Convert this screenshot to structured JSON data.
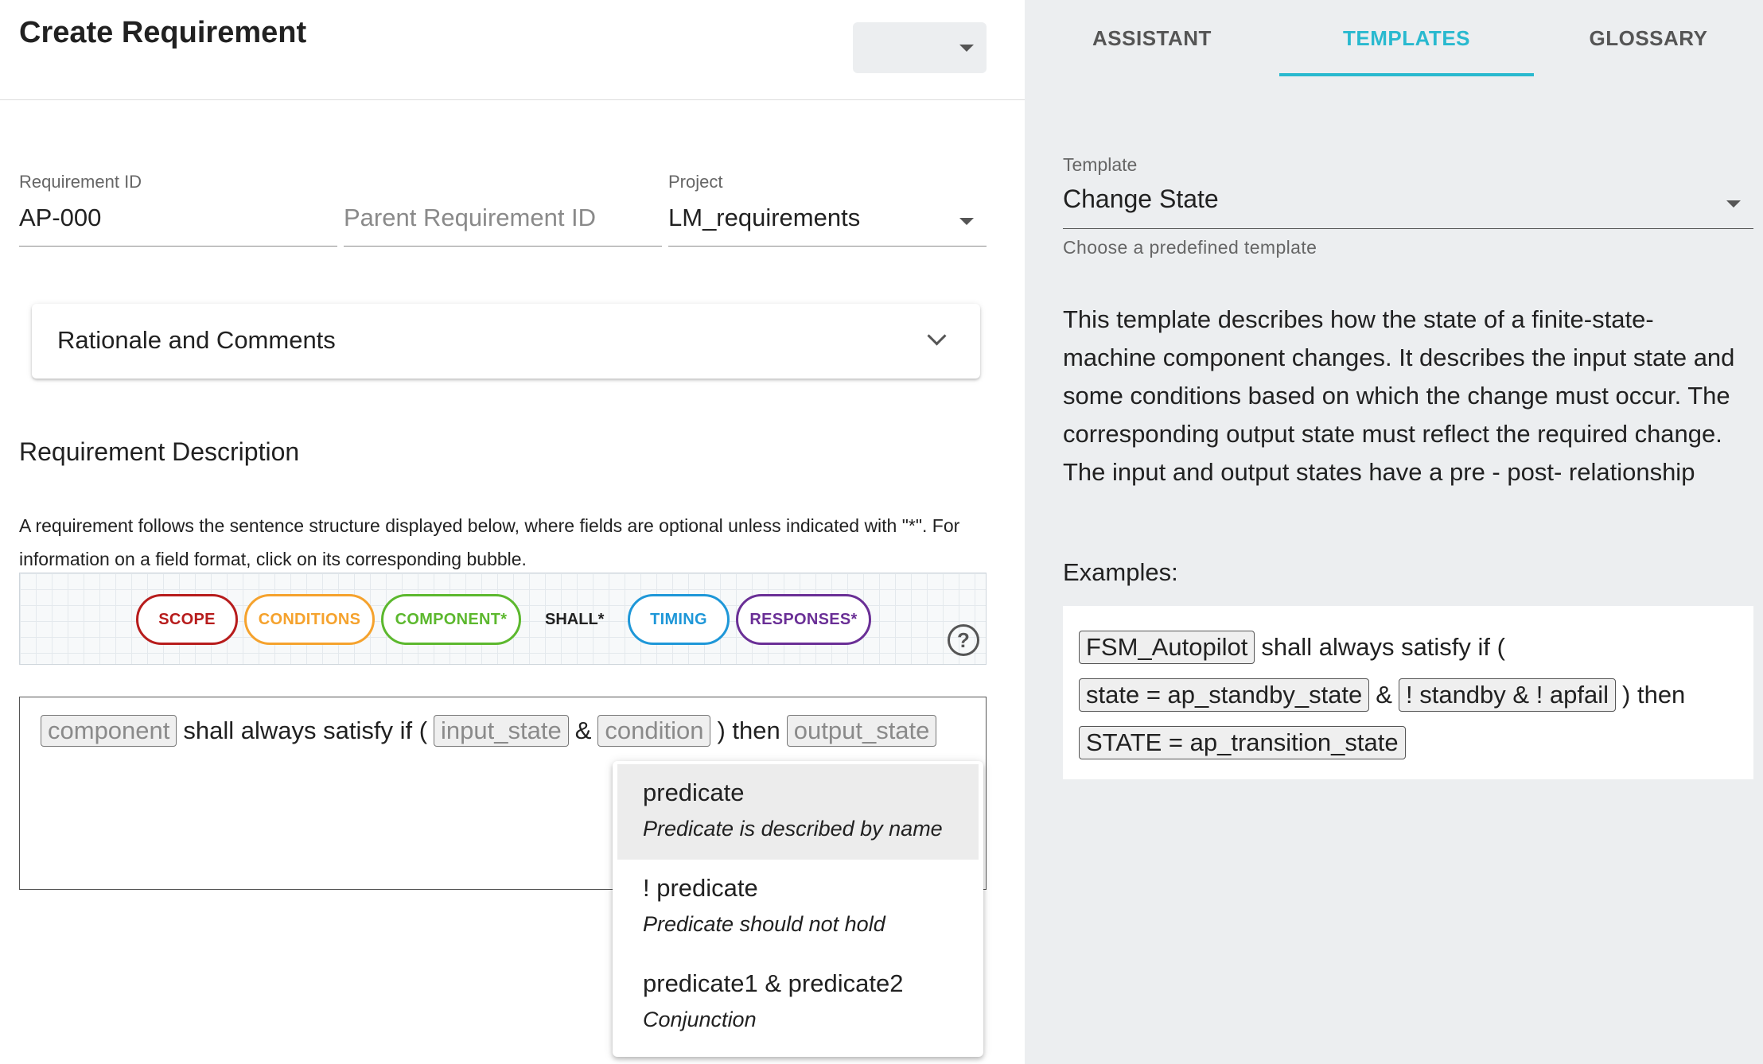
{
  "dialog": {
    "title": "Create Requirement"
  },
  "fields": {
    "requirement_id": {
      "label": "Requirement ID",
      "value": "AP-000"
    },
    "parent_id": {
      "placeholder": "Parent Requirement ID"
    },
    "project": {
      "label": "Project",
      "value": "LM_requirements"
    }
  },
  "accordion": {
    "title": "Rationale and Comments"
  },
  "description": {
    "title": "Requirement Description",
    "help": "A requirement follows the sentence structure displayed below, where fields are optional unless indicated with \"*\". For information on a field format, click on its corresponding bubble."
  },
  "bubbles": [
    {
      "label": "SCOPE",
      "color": "#b71c1c"
    },
    {
      "label": "CONDITIONS",
      "color": "#f5a22d"
    },
    {
      "label": "COMPONENT*",
      "color": "#5cb82e"
    },
    {
      "label": "TIMING",
      "color": "#1e97d8"
    },
    {
      "label": "RESPONSES*",
      "color": "#6a2f96"
    }
  ],
  "shall_label": "SHALL*",
  "help_icon": "?",
  "editor": {
    "tokens": [
      {
        "type": "ph",
        "text": "component"
      },
      {
        "type": "txt",
        "text": "shall always satisfy if ("
      },
      {
        "type": "ph",
        "text": "input_state"
      },
      {
        "type": "txt",
        "text": "&"
      },
      {
        "type": "ph",
        "text": "condition"
      },
      {
        "type": "txt",
        "text": ") then"
      },
      {
        "type": "ph",
        "text": "output_state"
      }
    ]
  },
  "autocomplete": [
    {
      "main": "predicate",
      "sub": "Predicate is described by name",
      "active": true
    },
    {
      "main": "! predicate",
      "sub": "Predicate should not hold",
      "active": false
    },
    {
      "main": "predicate1 & predicate2",
      "sub": "Conjunction",
      "active": false
    }
  ],
  "tabs": [
    {
      "label": "ASSISTANT",
      "active": false
    },
    {
      "label": "TEMPLATES",
      "active": true
    },
    {
      "label": "GLOSSARY",
      "active": false
    }
  ],
  "template": {
    "label": "Template",
    "value": "Change State",
    "hint": "Choose a predefined template",
    "description": "This template describes how the state of a finite-state-machine component changes. It describes the input state and some conditions based on which the change must occur. The corresponding output state must reflect the required change. The input and output states have a pre - post- relationship",
    "examples_label": "Examples:",
    "example_lines": [
      [
        {
          "type": "ph",
          "text": "FSM_Autopilot"
        },
        {
          "type": "txt",
          "text": "shall always satisfy if ("
        }
      ],
      [
        {
          "type": "ph",
          "text": "state = ap_standby_state"
        },
        {
          "type": "txt",
          "text": "&"
        },
        {
          "type": "ph",
          "text": "! standby & ! apfail"
        },
        {
          "type": "txt",
          "text": ") then"
        }
      ],
      [
        {
          "type": "ph",
          "text": "STATE = ap_transition_state"
        }
      ]
    ]
  }
}
